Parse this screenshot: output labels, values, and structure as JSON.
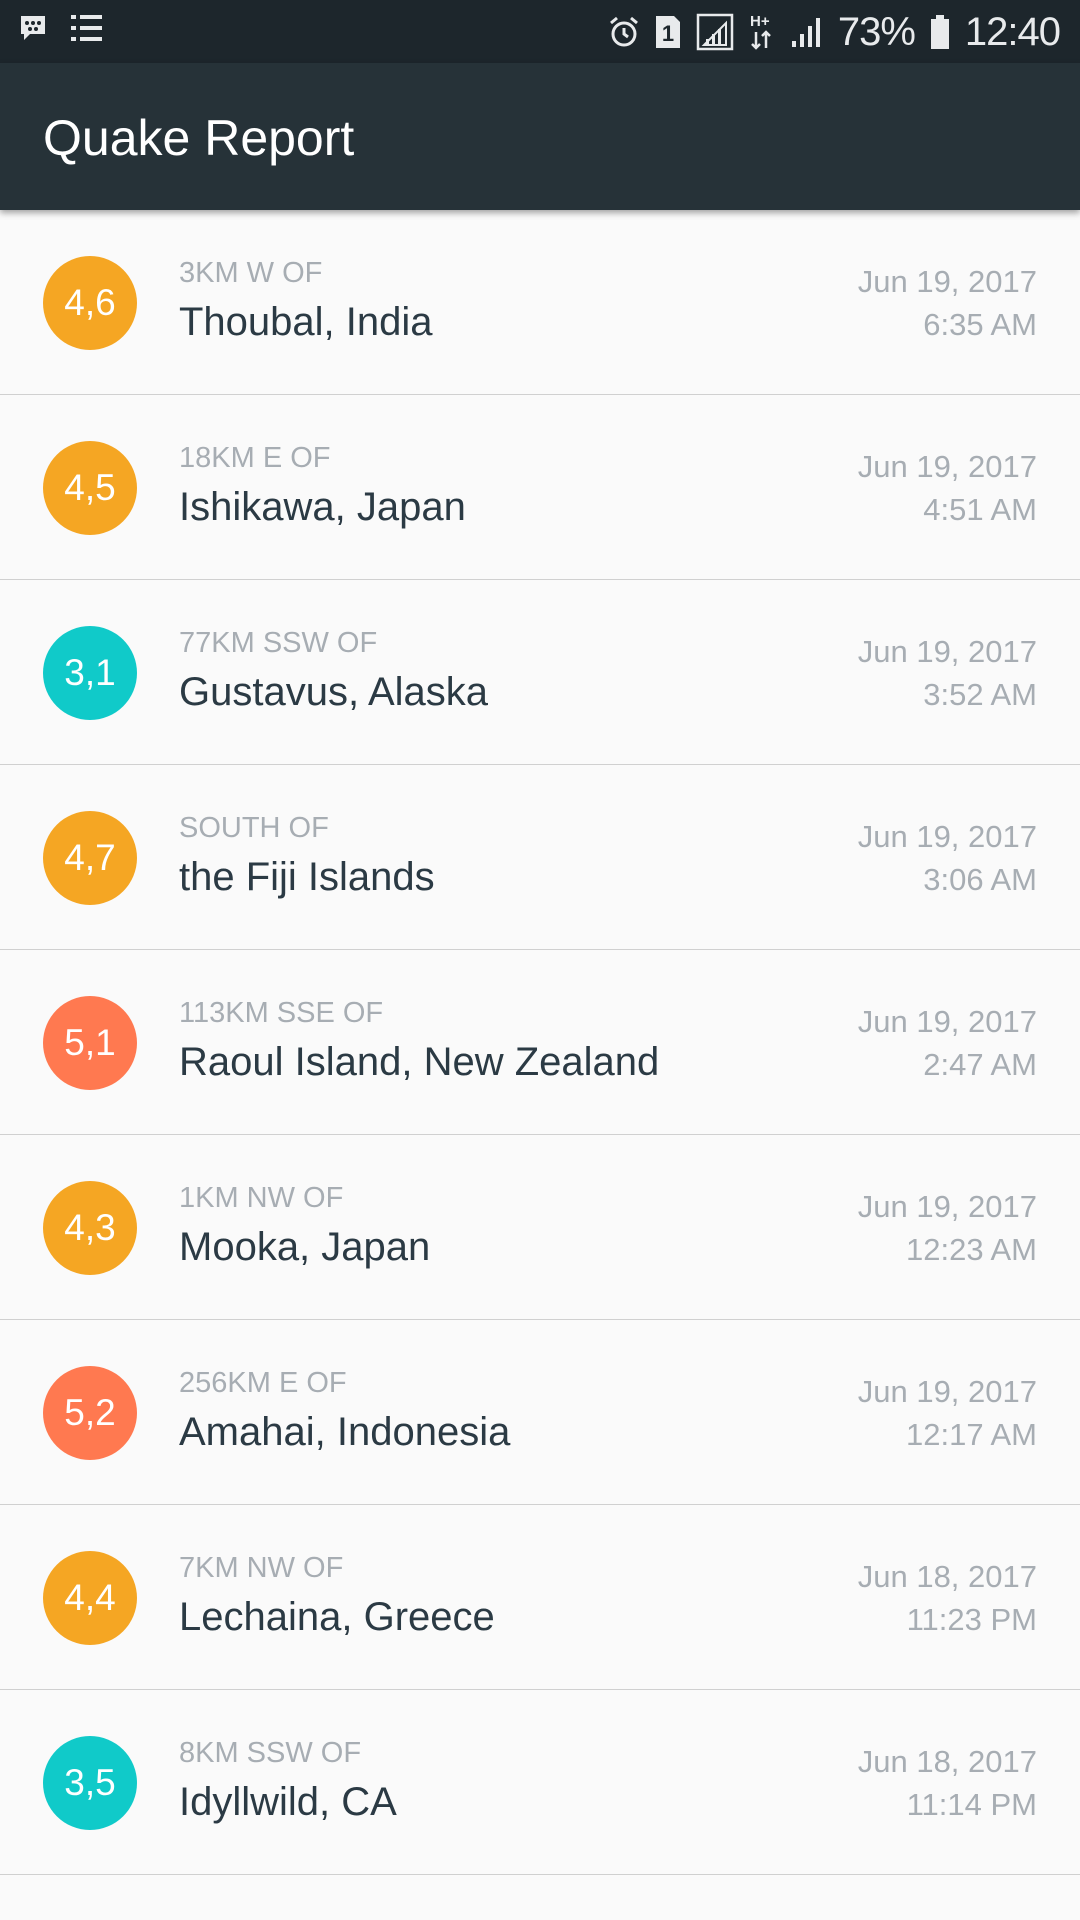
{
  "status_bar": {
    "battery_percent": "73%",
    "time": "12:40",
    "network_type": "H+",
    "sim_slot": "1",
    "icons": [
      "bbm-icon",
      "list-icon",
      "alarm-icon",
      "sim-icon",
      "signal-icon",
      "data-arrows-icon",
      "battery-icon"
    ]
  },
  "app_bar": {
    "title": "Quake Report"
  },
  "colors": {
    "app_bar": "#263238",
    "status_bar": "#1d262c",
    "mag_3": "#10cac9",
    "mag_4": "#f5a623",
    "mag_5": "#ff7950",
    "primary_text": "#2b3a44",
    "secondary_text": "#a7adb3"
  },
  "earthquakes": [
    {
      "magnitude": "4,6",
      "level": "4",
      "offset": "3km W of",
      "location": "Thoubal, India",
      "date": "Jun 19, 2017",
      "time": "6:35 AM"
    },
    {
      "magnitude": "4,5",
      "level": "4",
      "offset": "18km E of",
      "location": "Ishikawa, Japan",
      "date": "Jun 19, 2017",
      "time": "4:51 AM"
    },
    {
      "magnitude": "3,1",
      "level": "3",
      "offset": "77km SSW of",
      "location": "Gustavus, Alaska",
      "date": "Jun 19, 2017",
      "time": "3:52 AM"
    },
    {
      "magnitude": "4,7",
      "level": "4",
      "offset": "South of",
      "location": "the Fiji Islands",
      "date": "Jun 19, 2017",
      "time": "3:06 AM"
    },
    {
      "magnitude": "5,1",
      "level": "5",
      "offset": "113km SSE of",
      "location": "Raoul Island, New Zealand",
      "date": "Jun 19, 2017",
      "time": "2:47 AM"
    },
    {
      "magnitude": "4,3",
      "level": "4",
      "offset": "1km NW of",
      "location": "Mooka, Japan",
      "date": "Jun 19, 2017",
      "time": "12:23 AM"
    },
    {
      "magnitude": "5,2",
      "level": "5",
      "offset": "256km E of",
      "location": "Amahai, Indonesia",
      "date": "Jun 19, 2017",
      "time": "12:17 AM"
    },
    {
      "magnitude": "4,4",
      "level": "4",
      "offset": "7km NW of",
      "location": "Lechaina, Greece",
      "date": "Jun 18, 2017",
      "time": "11:23 PM"
    },
    {
      "magnitude": "3,5",
      "level": "3",
      "offset": "8km SSW of",
      "location": "Idyllwild, CA",
      "date": "Jun 18, 2017",
      "time": "11:14 PM"
    }
  ]
}
